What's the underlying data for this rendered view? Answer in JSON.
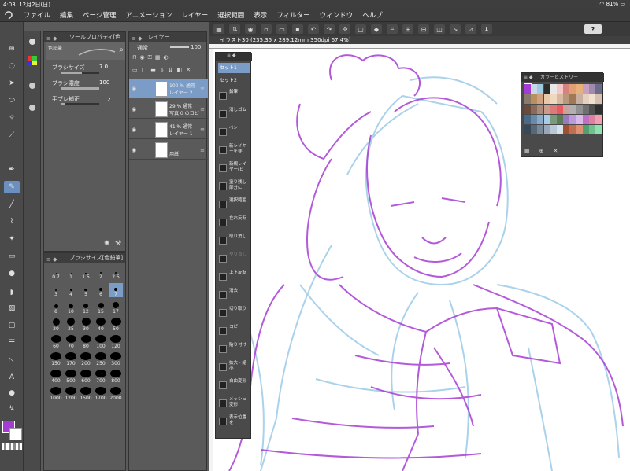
{
  "status": {
    "time": "4:03",
    "date": "12月2日(日)",
    "battery": "81%"
  },
  "menu": [
    "ファイル",
    "編集",
    "ページ管理",
    "アニメーション",
    "レイヤー",
    "選択範囲",
    "表示",
    "フィルター",
    "ウィンドウ",
    "ヘルプ"
  ],
  "command_bar": {
    "help_label": "?"
  },
  "canvas": {
    "title": "イラスト30 (235.35 x 289.12mm 350dpi 67.4%)"
  },
  "tool_property": {
    "tab_label": "ツールプロパティ[色鉛筆]",
    "preview_name": "色鉛筆",
    "rows": [
      {
        "label": "ブラシサイズ",
        "value": "7.0",
        "fill": 0.55
      },
      {
        "label": "ブラシ濃度",
        "value": "100",
        "fill": 1.0
      },
      {
        "label": "手ブレ補正",
        "value": "2",
        "fill": 0.1
      }
    ]
  },
  "brush_size": {
    "tab_label": "ブラシサイズ[色鉛筆]",
    "sizes": [
      "0.7",
      "1",
      "1.5",
      "2",
      "2.5",
      "3",
      "4",
      "5",
      "6",
      "7",
      "8",
      "10",
      "12",
      "15",
      "17",
      "20",
      "25",
      "30",
      "40",
      "50",
      "60",
      "70",
      "80",
      "100",
      "120",
      "150",
      "170",
      "200",
      "250",
      "300",
      "400",
      "500",
      "600",
      "700",
      "800",
      "1000",
      "1200",
      "1500",
      "1700",
      "2000"
    ],
    "selected": "7"
  },
  "layers": {
    "tab_label": "レイヤー",
    "blend_mode": "通常",
    "opacity": "100",
    "items": [
      {
        "line1": "100 % 通常",
        "line2": "レイヤー 2",
        "selected": true
      },
      {
        "line1": "29 % 通常",
        "line2": "写真 0 のコピ",
        "selected": false
      },
      {
        "line1": "41 % 通常",
        "line2": "レイヤー 1",
        "selected": false
      },
      {
        "line1": "",
        "line2": "用紙",
        "selected": false
      }
    ]
  },
  "palette": {
    "sets": [
      "セット1",
      "セット2"
    ],
    "items": [
      {
        "label": "鉛筆",
        "enabled": true
      },
      {
        "label": "消しゴム",
        "enabled": true
      },
      {
        "label": "ペン",
        "enabled": true
      },
      {
        "label": "新レイヤーを非",
        "enabled": true
      },
      {
        "label": "新規レイヤー(ビ",
        "enabled": true
      },
      {
        "label": "塗り残し部分に",
        "enabled": true
      },
      {
        "label": "選択範囲",
        "enabled": true
      },
      {
        "label": "左右反転",
        "enabled": true
      },
      {
        "label": "取り消し",
        "enabled": true
      },
      {
        "label": "やり直し",
        "enabled": false
      },
      {
        "label": "上下反転",
        "enabled": true
      },
      {
        "label": "消去",
        "enabled": true
      },
      {
        "label": "切り取り",
        "enabled": true
      },
      {
        "label": "コピー",
        "enabled": true
      },
      {
        "label": "貼り付け",
        "enabled": true
      },
      {
        "label": "拡大・縮小",
        "enabled": true
      },
      {
        "label": "自由変形",
        "enabled": true
      },
      {
        "label": "メッシュ変形",
        "enabled": true
      },
      {
        "label": "表示位置を",
        "enabled": true
      }
    ]
  },
  "color_history": {
    "tab_label": "カラーヒストリー",
    "colors": [
      "#a43bd4",
      "#c9d8e8",
      "#9ecbe0",
      "#2b2b2b",
      "#e8e8e8",
      "#f5c7c7",
      "#d98080",
      "#e0a070",
      "#e8b07a",
      "#c7a0c0",
      "#a08bb0",
      "#6b6b8b",
      "#8a7a6a",
      "#b89060",
      "#d0a080",
      "#e8c8a8",
      "#f0d8c0",
      "#d8b8a0",
      "#b8987a",
      "#a07858",
      "#c8b0a0",
      "#e8d0c0",
      "#f0e0d0",
      "#d8c0b0",
      "#6a4a3a",
      "#8a6a5a",
      "#aa8a7a",
      "#ca9a8a",
      "#da7a7a",
      "#ea5a5a",
      "#caa0a0",
      "#b0b0b0",
      "#909090",
      "#707070",
      "#505050",
      "#303030",
      "#4a6a8a",
      "#6a8aaa",
      "#8aaaca",
      "#aacaea",
      "#7a9a7a",
      "#5a7a5a",
      "#9a7aba",
      "#ba9ada",
      "#dabaea",
      "#c070c0",
      "#e080a0",
      "#f0a0b0",
      "#384858",
      "#586878",
      "#788898",
      "#98a8b8",
      "#b8c8d8",
      "#d8e0e8",
      "#a05030",
      "#c07050",
      "#e09070",
      "#50a070",
      "#70c090",
      "#90e0b0"
    ]
  }
}
